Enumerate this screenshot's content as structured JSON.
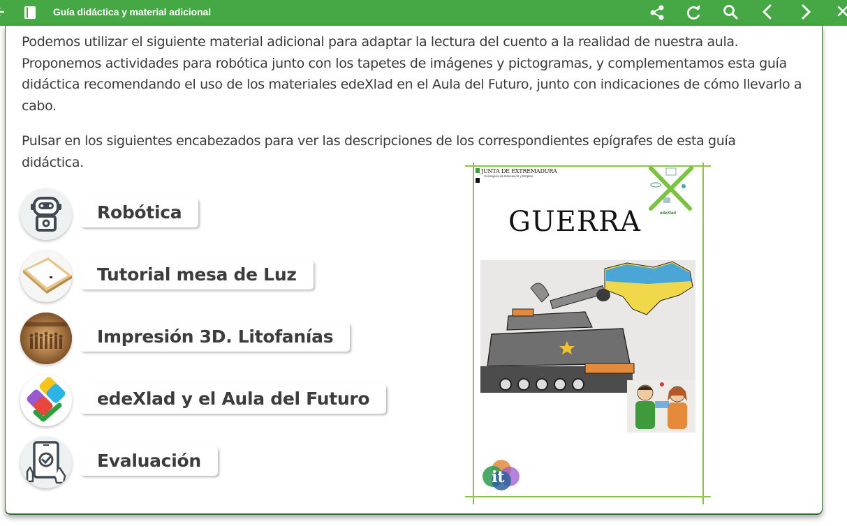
{
  "header": {
    "title": "Guía didáctica y material adicional",
    "background": "#45a844",
    "icons": [
      "back-arrow-icon",
      "book-icon",
      "share-icon",
      "reload-icon",
      "search-icon",
      "chevron-left-icon",
      "chevron-right-icon",
      "close-icon"
    ]
  },
  "content": {
    "paragraph1": "Podemos utilizar el siguiente material adicional para adaptar la lectura del cuento a la realidad de nuestra aula. Proponemos actividades para robótica junto con los tapetes de imágenes y pictogramas, y complementamos esta guía didáctica recomendando el uso de los materiales edeXlad en el Aula del Futuro, junto con indicaciones de cómo llevarlo a cabo.",
    "paragraph2": "Pulsar en los siguientes encabezados para ver las descripciones de los correspondientes epígrafes de esta guía didáctica."
  },
  "items": [
    {
      "label": "Robótica",
      "icon": "robot-icon"
    },
    {
      "label": "Tutorial mesa de Luz",
      "icon": "light-table-icon"
    },
    {
      "label": "Impresión 3D. Litofanías",
      "icon": "lithophane-icon"
    },
    {
      "label": "edeXlad y el Aula del Futuro",
      "icon": "edexlad-logo-icon"
    },
    {
      "label": "Evaluación",
      "icon": "tablet-check-icon"
    }
  ],
  "cover": {
    "junta": "JUNTA DE EXTREMADURA",
    "consejeria": "Consejería de Educación y Empleo",
    "title": "GUERRA",
    "edexlad": "edeXlad",
    "accent": "#8bc34a"
  }
}
